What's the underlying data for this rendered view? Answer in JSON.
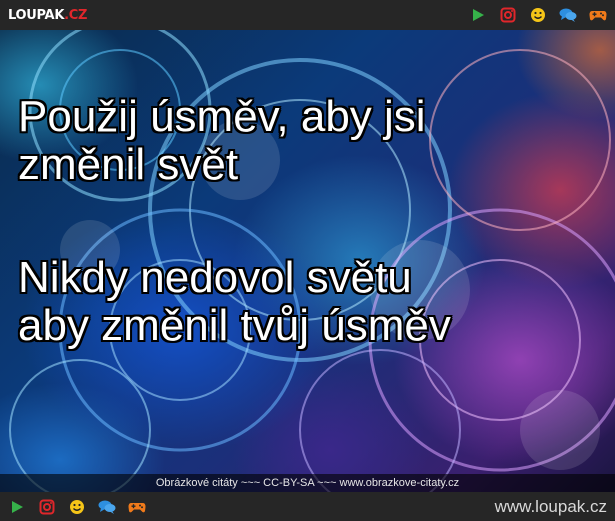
{
  "header": {
    "logo_main": "LOUPAK",
    "logo_suffix": ".CZ",
    "icons": [
      "play-icon",
      "instagram-icon",
      "smiley-icon",
      "chat-icon",
      "gamepad-icon"
    ]
  },
  "image": {
    "quote_line_1": "Použij úsměv, aby jsi",
    "quote_line_2": "změnil svět",
    "quote_line_3": "Nikdy nedovol světu",
    "quote_line_4": "aby změnil tvůj úsměv",
    "caption": "Obrázkové citáty ~~~ CC-BY-SA ~~~ www.obrazkove-citaty.cz"
  },
  "footer": {
    "icons": [
      "play-icon",
      "instagram-icon",
      "smiley-icon",
      "chat-icon",
      "gamepad-icon"
    ],
    "site_url": "www.loupak.cz"
  },
  "colors": {
    "bar_background": "#262626",
    "logo_accent": "#e0262b",
    "play": "#36b24a",
    "instagram": "#e0262b",
    "smiley": "#f5c518",
    "chat": "#2d8fe0",
    "gamepad": "#f07a1a"
  }
}
